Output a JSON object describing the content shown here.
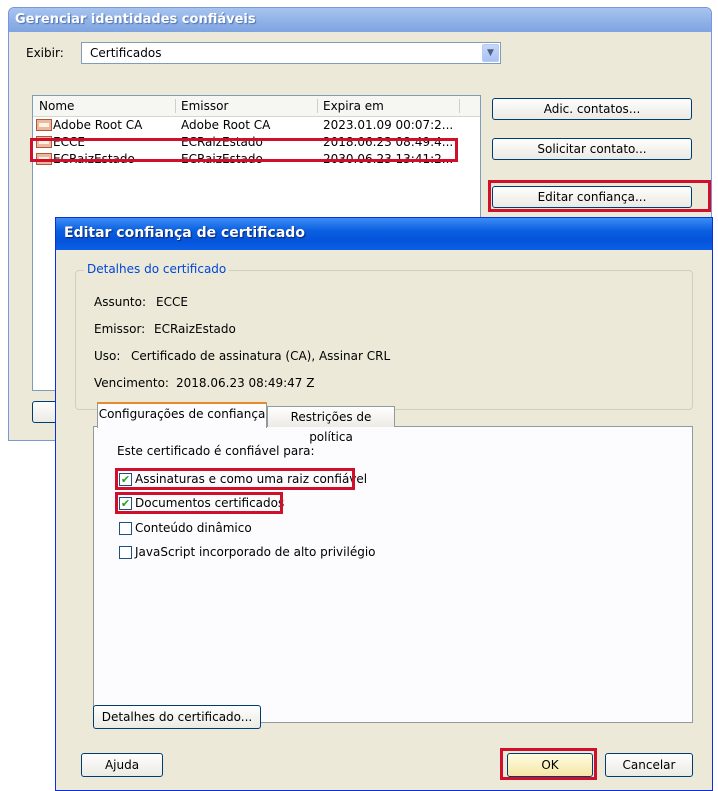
{
  "bg_window": {
    "title": "Gerenciar identidades confiáveis",
    "show_label": "Exibir:",
    "show_value": "Certificados",
    "columns": [
      "Nome",
      "Emissor",
      "Expira em"
    ],
    "rows": [
      {
        "name": "Adobe Root CA",
        "issuer": "Adobe Root CA",
        "expires": "2023.01.09 00:07:2..."
      },
      {
        "name": "ECCE",
        "issuer": "ECRaizEstado",
        "expires": "2018.06.23 08:49:4..."
      },
      {
        "name": "ECRaizEstado",
        "issuer": "ECRaizEstado",
        "expires": "2030.06.23 13:41:2..."
      }
    ],
    "buttons": {
      "add_contacts": "Adic. contatos...",
      "request_contact": "Solicitar contato...",
      "edit_trust": "Editar confiança..."
    }
  },
  "dialog": {
    "title": "Editar confiança de certificado",
    "details_group": "Detalhes do certificado",
    "subject_label": "Assunto:",
    "subject_value": "ECCE",
    "issuer_label": "Emissor:",
    "issuer_value": "ECRaizEstado",
    "usage_label": "Uso:",
    "usage_value": "Certificado de assinatura (CA), Assinar CRL",
    "expiry_label": "Vencimento:",
    "expiry_value": "2018.06.23 08:49:47 Z",
    "tabs": [
      "Configurações de confiança",
      "Restrições de política"
    ],
    "trust_heading": "Este certificado é confiável para:",
    "options": [
      {
        "label": "Assinaturas e como uma raiz confiável",
        "checked": true
      },
      {
        "label": "Documentos certificados",
        "checked": true
      },
      {
        "label": "Conteúdo dinâmico",
        "checked": false
      },
      {
        "label": "JavaScript incorporado de alto privilégio",
        "checked": false
      }
    ],
    "cert_details_button": "Detalhes do certificado...",
    "help_button": "Ajuda",
    "ok_button": "OK",
    "cancel_button": "Cancelar"
  },
  "colors": {
    "highlight": "#d0102a",
    "xp_blue": "#0454dc",
    "group_label": "#0046d5"
  },
  "icons": {
    "cert_row": "certificate-icon",
    "checkmark": "✔",
    "dropdown": "chevron-down-icon"
  }
}
